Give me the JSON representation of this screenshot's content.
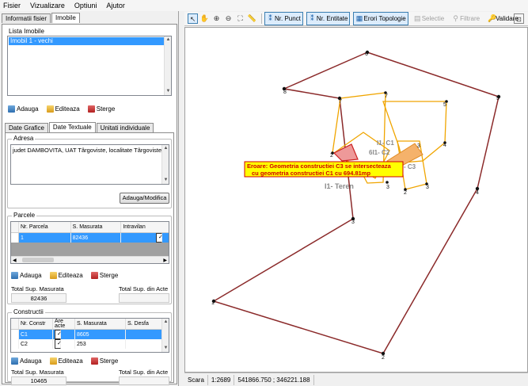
{
  "menu": [
    "Fisier",
    "Vizualizare",
    "Optiuni",
    "Ajutor"
  ],
  "left_tabs": [
    "Informatii fisier",
    "Imobile"
  ],
  "lista_imobile": {
    "title": "Lista Imobile",
    "items": [
      "Imobil 1 - vechi"
    ]
  },
  "actions": {
    "add": "Adauga",
    "edit": "Editeaza",
    "delete": "Sterge"
  },
  "detail_tabs": [
    "Date Grafice",
    "Date Textuale",
    "Unitati individuale"
  ],
  "adresa": {
    "title": "Adresa",
    "value": "judet DAMBOVITA, UAT Târgoviste, localitate Târgoviste",
    "button": "Adauga/Modifica"
  },
  "parcele": {
    "title": "Parcele",
    "columns": [
      "Nr. Parcela",
      "S. Masurata",
      "Intravilan"
    ],
    "rows": [
      {
        "nr": "1",
        "suprafata": "82436",
        "intravilan": true
      }
    ],
    "total_masurata_label": "Total Sup. Masurata",
    "total_acte_label": "Total Sup. din Acte",
    "total_masurata": "82436",
    "total_acte": ""
  },
  "constructii": {
    "title": "Constructii",
    "columns": [
      "Nr. Constr",
      "Are acte",
      "S. Masurata",
      "S. Desfa"
    ],
    "rows": [
      {
        "nr": "C1",
        "acte": true,
        "suprafata": "8605"
      },
      {
        "nr": "C2",
        "acte": true,
        "suprafata": "253"
      }
    ],
    "total_masurata_label": "Total Sup. Masurata",
    "total_acte_label": "Total Sup. din Acte",
    "total_masurata": "10465",
    "total_acte": ""
  },
  "toolbar": {
    "nr_punct": "Nr. Punct",
    "nr_entitate": "Nr. Entitate",
    "erori": "Erori Topologie",
    "selectie": "Selectie",
    "filtrare": "Filtrare",
    "validare": "Validare"
  },
  "map": {
    "error_line1": "Eroare: Geometria constructiei C3 se intersecteaza",
    "error_line2": "cu geometria constructiei C1 cu 694.81mp",
    "label_teren": "I1- Teren",
    "label_c1": "I1- C1",
    "label_c2": "6I1- C2",
    "label_c3": "- C3",
    "colors": {
      "parcel": "#8b2a2a",
      "building": "#f0a500",
      "error_fill": "#f5b26b",
      "error_box": "#ffff00",
      "error_text": "#d00000"
    }
  },
  "status": {
    "scara_label": "Scara",
    "scara_value": "1:2689",
    "coords": "541866.750 ; 346221.188"
  }
}
